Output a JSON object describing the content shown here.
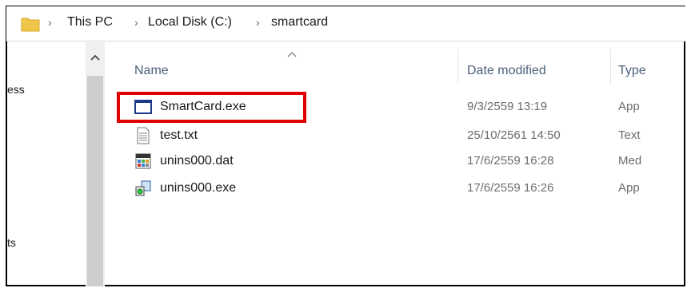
{
  "address_bar": {
    "folder_icon": "folder-icon",
    "breadcrumbs": [
      "This PC",
      "Local Disk (C:)",
      "smartcard"
    ]
  },
  "nav_pane": {
    "partial_items": [
      "ess",
      "ts"
    ]
  },
  "columns": {
    "name": "Name",
    "date_modified": "Date modified",
    "type": "Type"
  },
  "files": [
    {
      "name": "SmartCard.exe",
      "date": "9/3/2559 13:19",
      "type": "App",
      "icon": "window-app-icon"
    },
    {
      "name": "test.txt",
      "date": "25/10/2561 14:50",
      "type": "Text",
      "icon": "text-file-icon"
    },
    {
      "name": "unins000.dat",
      "date": "17/6/2559 16:28",
      "type": "Med",
      "icon": "media-file-icon"
    },
    {
      "name": "unins000.exe",
      "date": "17/6/2559 16:26",
      "type": "App",
      "icon": "installer-icon"
    }
  ],
  "highlight": {
    "target": "SmartCard.exe",
    "color": "#e00000"
  }
}
